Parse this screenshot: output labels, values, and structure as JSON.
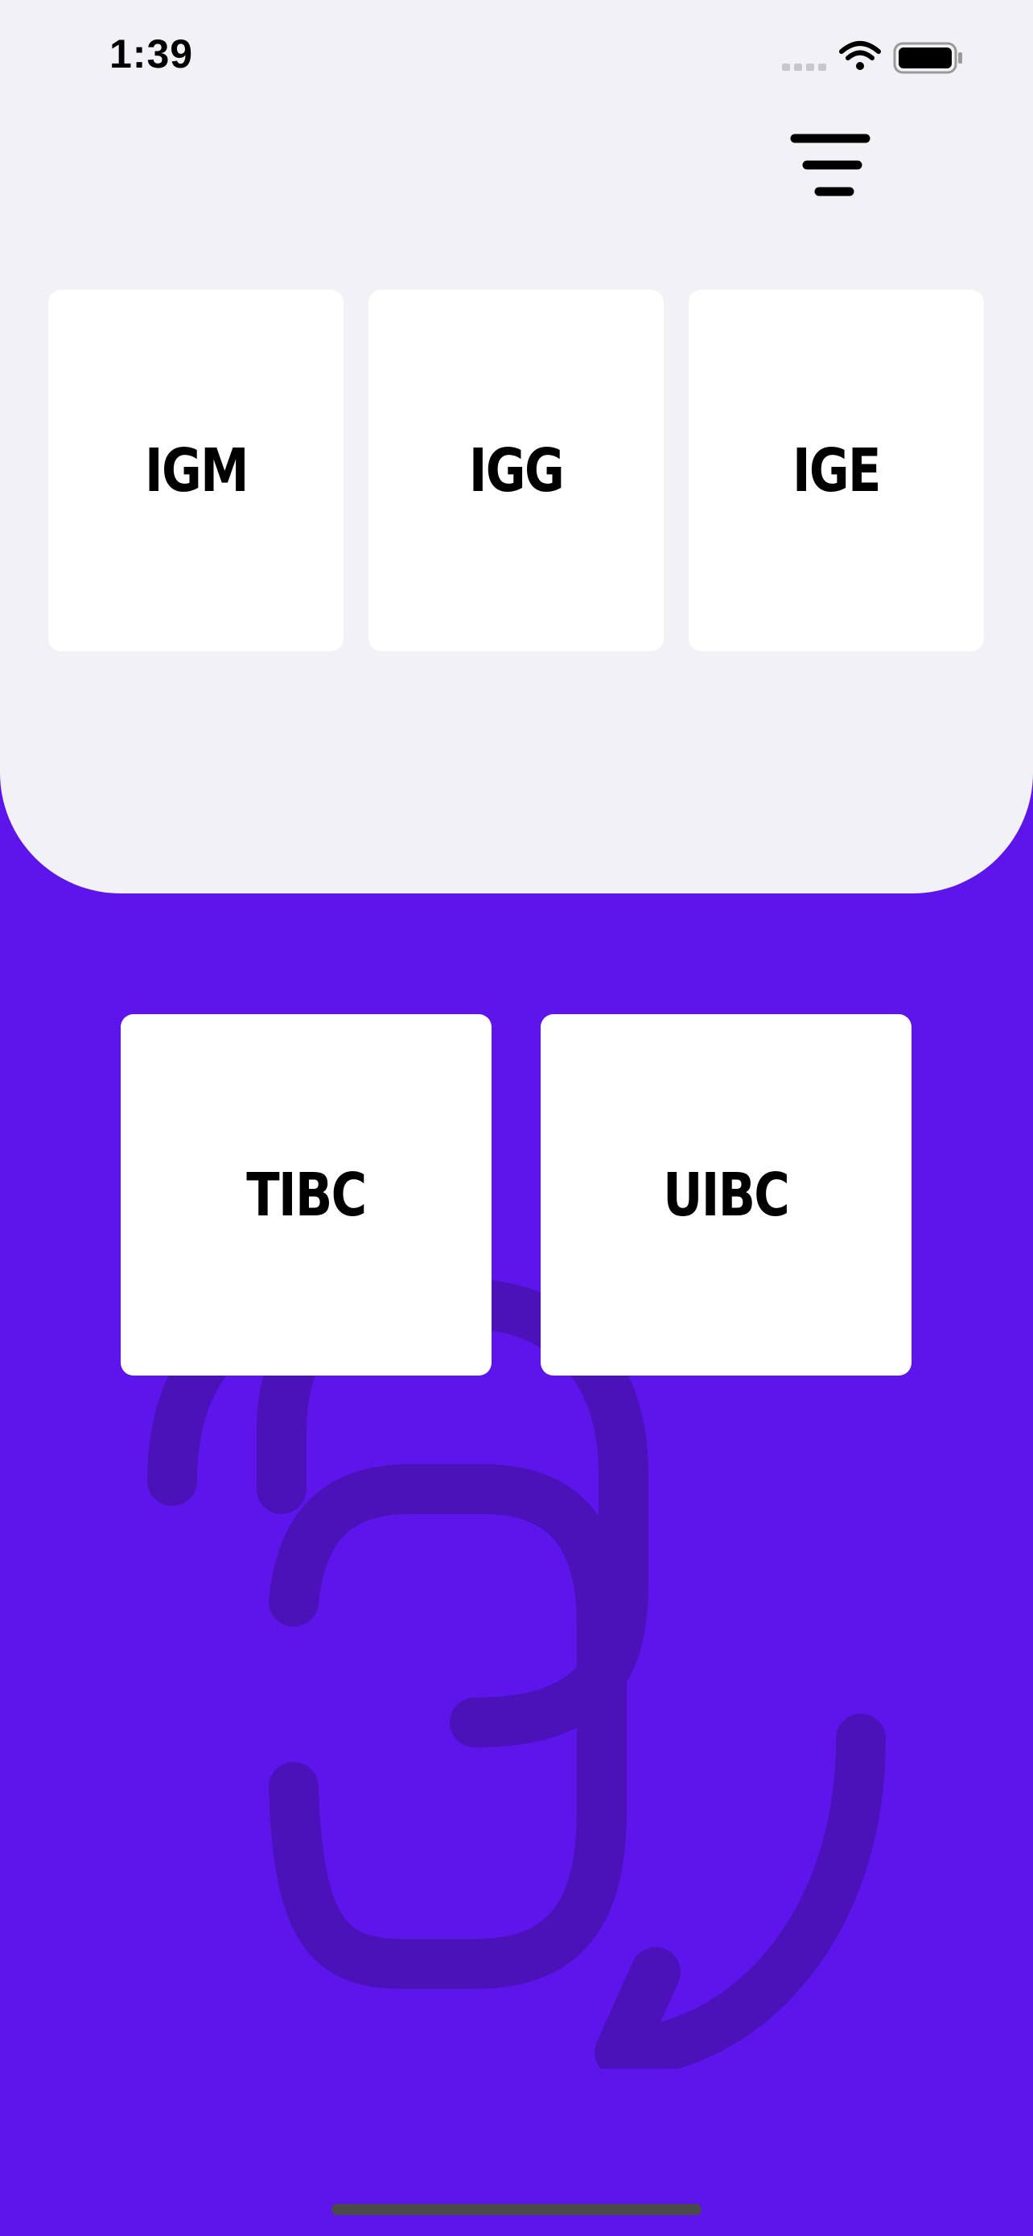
{
  "status_bar": {
    "time": "1:39",
    "icons": [
      "cellular-signal-icon",
      "wifi-icon",
      "battery-icon"
    ]
  },
  "header": {
    "menu_icon": "filter-menu-icon"
  },
  "top_cards": [
    {
      "label": "IGM"
    },
    {
      "label": "IGG"
    },
    {
      "label": "IGE"
    }
  ],
  "bottom_cards": [
    {
      "label": "TIBC"
    },
    {
      "label": "UIBC"
    }
  ],
  "background_icon": "swap-rotate-icon",
  "colors": {
    "accent_purple": "#5e15eb",
    "panel_gray": "#f2f1f6",
    "card_white": "#ffffff",
    "watermark": "#4a12b8"
  }
}
